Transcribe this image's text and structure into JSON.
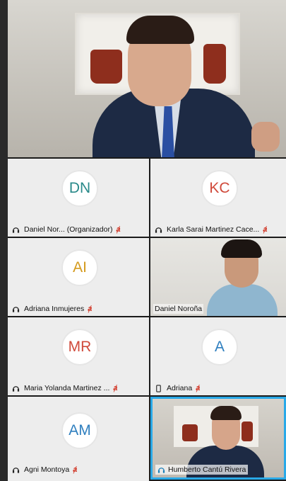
{
  "main_speaker": {
    "icon": "speaker-video"
  },
  "tiles": [
    {
      "initials": "DN",
      "initials_color": "#2a8a8a",
      "name": "Daniel Nor... (Organizador)",
      "audio_icon": "headset-icon",
      "muted": true
    },
    {
      "initials": "KC",
      "initials_color": "#d04a3b",
      "name": "Karla Sarai Martinez Cace...",
      "audio_icon": "headset-icon",
      "muted": true
    },
    {
      "initials": "AI",
      "initials_color": "#d49a1c",
      "name": "Adriana Inmujeres",
      "audio_icon": "headset-icon",
      "muted": true
    },
    {
      "video": true,
      "name": "Daniel Noroña"
    },
    {
      "initials": "MR",
      "initials_color": "#d04a3b",
      "name": "Maria Yolanda Martinez ...",
      "audio_icon": "headset-icon",
      "muted": true
    },
    {
      "initials": "A",
      "initials_color": "#2f7fbf",
      "name": "Adriana",
      "audio_icon": "phone-icon",
      "muted": true
    },
    {
      "initials": "AM",
      "initials_color": "#2f7fbf",
      "name": "Agni Montoya",
      "audio_icon": "headset-icon",
      "muted": true
    },
    {
      "video": true,
      "name": "Humberto Cantú Rivera",
      "active_speaker": true
    }
  ],
  "mute_glyph": "ⱥ",
  "colors": {
    "active_border": "#29a9e8",
    "tile_bg": "#ededed",
    "muted": "#d23a2a"
  }
}
